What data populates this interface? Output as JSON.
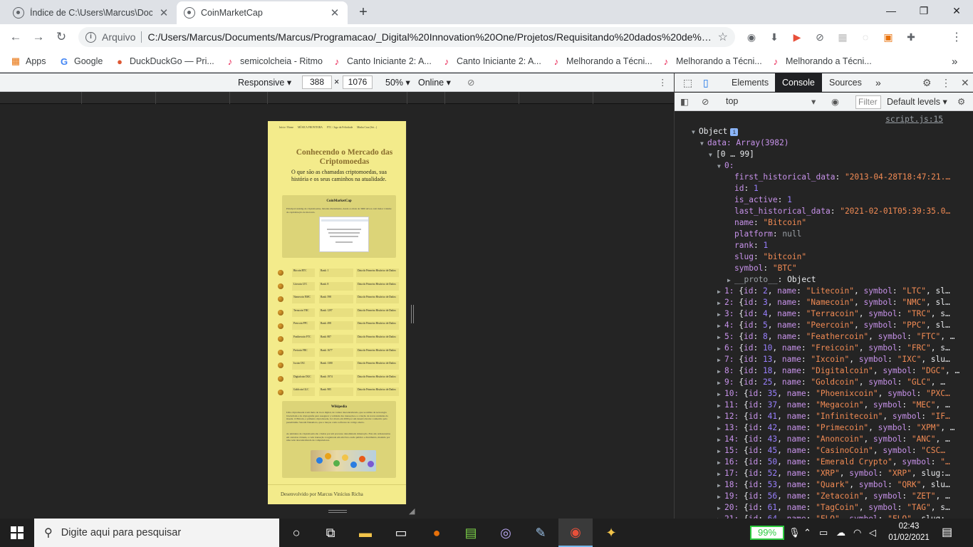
{
  "tabs": [
    {
      "title": "Índice de C:\\Users\\Marcus\\Documents",
      "close": "✕"
    },
    {
      "title": "CoinMarketCap",
      "close": "✕"
    }
  ],
  "new_tab": "+",
  "window_controls": {
    "minimize": "—",
    "maximize": "❐",
    "close": "✕"
  },
  "address": {
    "scheme": "Arquivo",
    "url": "C:/Users/Marcus/Documents/Marcus/Programacao/_Digital%20Innovation%20One/Projetos/Requisitando%20dados%20de%20..."
  },
  "profile_initial": "M",
  "bookmarks": [
    {
      "label": "Apps",
      "icon": "apps-grid-icon"
    },
    {
      "label": "Google",
      "icon": "google-icon"
    },
    {
      "label": "DuckDuckGo — Pri...",
      "icon": "duckduckgo-icon"
    },
    {
      "label": "semicolcheia - Ritmo",
      "icon": "music-note-icon"
    },
    {
      "label": "Canto Iniciante 2: A...",
      "icon": "music-note-icon"
    },
    {
      "label": "Canto Iniciante 2: A...",
      "icon": "music-note-icon"
    },
    {
      "label": "Melhorando a Técni...",
      "icon": "music-note-icon"
    },
    {
      "label": "Melhorando a Técni...",
      "icon": "music-note-icon"
    },
    {
      "label": "Melhorando a Técni...",
      "icon": "music-note-icon"
    }
  ],
  "bookmarks_more": "»",
  "device_toolbar": {
    "device": "Responsive",
    "width": "388",
    "times": "×",
    "height": "1076",
    "zoom": "50%",
    "network": "Online"
  },
  "site": {
    "nav": [
      "Início / Home",
      "MÚSICA FRONTEIRA",
      "FTC / Jogo da Felicidade",
      "Minha Cruz (Set...)"
    ],
    "title": "Conhecendo o Mercado das Criptomoedas",
    "subtitle": "O que são as chamadas criptomoedas, sua história e os seus caminhos na atualidade.",
    "card1_title": "CoinMarketCap",
    "card1_text": "Principal ranking de criptomoedas, listadas diariamente, desde os mais de 3900 ativos com maior volume de capitalização de mercado.",
    "card2_title": "Wikipedia",
    "card2_text": "Uma criptomoeda é um meio de troca digital, de caráter descentralizado, que se utiliza da tecnologia blockchain e da criptografia para assegurar a validade das transações e a criação de novas unidades da moeda. O Bitcoin, a primeira criptomoeda, foi criado em 2009 por um desenvolvedor conhecido pelo pseudônimo Satoshi Nakamoto, que a lançou como software de código aberto.",
    "card2_text2": "As unidades de criptomoeda são criadas por um processo denominado mineração. Elas são armazenadas em carteiras virtuais, e cada transação é registrada em um livro-razão público e distribuído, mantido por uma rede descentralizada de computadores.",
    "coins": [
      {
        "name": "Bitcoin",
        "symbol": "BTC",
        "rank": "Rank: 1"
      },
      {
        "name": "Litecoin",
        "symbol": "LTC",
        "rank": "Rank: 8"
      },
      {
        "name": "Namecoin",
        "symbol": "NMC",
        "rank": "Rank: 598"
      },
      {
        "name": "Terracoin",
        "symbol": "TRC",
        "rank": "Rank: 1297"
      },
      {
        "name": "Peercoin",
        "symbol": "PPC",
        "rank": "Rank: 498"
      },
      {
        "name": "Feathercoin",
        "symbol": "FTC",
        "rank": "Rank: 887"
      },
      {
        "name": "Freicoin",
        "symbol": "FRC",
        "rank": "Rank: 1677"
      },
      {
        "name": "Ixcoin",
        "symbol": "IXC",
        "rank": "Rank: 1380"
      },
      {
        "name": "Digitalcoin",
        "symbol": "DGC",
        "rank": "Rank: 1974"
      },
      {
        "name": "Goldcoin",
        "symbol": "GLC",
        "rank": "Rank: 985"
      }
    ],
    "coin_date_label": "Data do Primeiro Histórico de Dados:",
    "footer": "Desenvolvido por Marcus Vinícius Richa"
  },
  "devtools": {
    "tabs": [
      "Elements",
      "Console",
      "Sources"
    ],
    "more": "»",
    "context": "top",
    "filter_placeholder": "Filter",
    "levels": "Default levels",
    "source": "script.js:15",
    "object_label": "Object",
    "badge": "i",
    "data_line": "data: Array(3982)",
    "range": "[0 … 99]",
    "index0": "0:",
    "props": [
      {
        "key": "first_historical_data",
        "value": "\"2013-04-28T18:47:21.…",
        "type": "s"
      },
      {
        "key": "id",
        "value": "1",
        "type": "n"
      },
      {
        "key": "is_active",
        "value": "1",
        "type": "n"
      },
      {
        "key": "last_historical_data",
        "value": "\"2021-02-01T05:39:35.0…",
        "type": "s"
      },
      {
        "key": "name",
        "value": "\"Bitcoin\"",
        "type": "s"
      },
      {
        "key": "platform",
        "value": "null",
        "type": "g"
      },
      {
        "key": "rank",
        "value": "1",
        "type": "n"
      },
      {
        "key": "slug",
        "value": "\"bitcoin\"",
        "type": "s"
      },
      {
        "key": "symbol",
        "value": "\"BTC\"",
        "type": "s"
      },
      {
        "key": "__proto__",
        "value": "Object",
        "type": "w"
      }
    ],
    "items": [
      {
        "idx": "1:",
        "id": "2",
        "name": "\"Litecoin\"",
        "symbol": "\"LTC\"",
        "tail": "sl…"
      },
      {
        "idx": "2:",
        "id": "3",
        "name": "\"Namecoin\"",
        "symbol": "\"NMC\"",
        "tail": "sl…"
      },
      {
        "idx": "3:",
        "id": "4",
        "name": "\"Terracoin\"",
        "symbol": "\"TRC\"",
        "tail": "s…"
      },
      {
        "idx": "4:",
        "id": "5",
        "name": "\"Peercoin\"",
        "symbol": "\"PPC\"",
        "tail": "sl…"
      },
      {
        "idx": "5:",
        "id": "8",
        "name": "\"Feathercoin\"",
        "symbol": "\"FTC\"",
        "tail": "…"
      },
      {
        "idx": "6:",
        "id": "10",
        "name": "\"Freicoin\"",
        "symbol": "\"FRC\"",
        "tail": "s…"
      },
      {
        "idx": "7:",
        "id": "13",
        "name": "\"Ixcoin\"",
        "symbol": "\"IXC\"",
        "tail": "slu…"
      },
      {
        "idx": "8:",
        "id": "18",
        "name": "\"Digitalcoin\"",
        "symbol": "\"DGC\"",
        "tail": "…"
      },
      {
        "idx": "9:",
        "id": "25",
        "name": "\"Goldcoin\"",
        "symbol": "\"GLC\"",
        "tail": "…"
      },
      {
        "idx": "10:",
        "id": "35",
        "name": "\"Phoenixcoin\"",
        "symbol": "\"PXC…",
        "tail": ""
      },
      {
        "idx": "11:",
        "id": "37",
        "name": "\"Megacoin\"",
        "symbol": "\"MEC\"",
        "tail": "…"
      },
      {
        "idx": "12:",
        "id": "41",
        "name": "\"Infinitecoin\"",
        "symbol": "\"IF…",
        "tail": ""
      },
      {
        "idx": "13:",
        "id": "42",
        "name": "\"Primecoin\"",
        "symbol": "\"XPM\"",
        "tail": "…"
      },
      {
        "idx": "14:",
        "id": "43",
        "name": "\"Anoncoin\"",
        "symbol": "\"ANC\"",
        "tail": "…"
      },
      {
        "idx": "15:",
        "id": "45",
        "name": "\"CasinoCoin\"",
        "symbol": "\"CSC…",
        "tail": ""
      },
      {
        "idx": "16:",
        "id": "50",
        "name": "\"Emerald Crypto\"",
        "symbol": "\"…",
        "tail": ""
      },
      {
        "idx": "17:",
        "id": "52",
        "name": "\"XRP\"",
        "symbol": "\"XRP\"",
        "tail": "slug:…"
      },
      {
        "idx": "18:",
        "id": "53",
        "name": "\"Quark\"",
        "symbol": "\"QRK\"",
        "tail": "slu…"
      },
      {
        "idx": "19:",
        "id": "56",
        "name": "\"Zetacoin\"",
        "symbol": "\"ZET\"",
        "tail": "…"
      },
      {
        "idx": "20:",
        "id": "61",
        "name": "\"TagCoin\"",
        "symbol": "\"TAG\"",
        "tail": "s…"
      },
      {
        "idx": "21:",
        "id": "64",
        "name": "\"FLO\"",
        "symbol": "\"FLO\"",
        "tail": "slug:…"
      }
    ]
  },
  "taskbar": {
    "search_placeholder": "Digite aqui para pesquisar",
    "battery": "99%",
    "time": "02:43",
    "date": "01/02/2021",
    "notifications": "1"
  }
}
